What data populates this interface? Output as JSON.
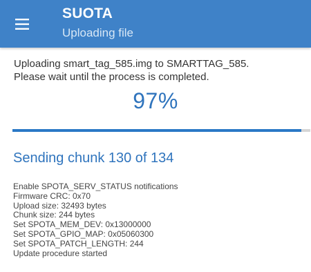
{
  "appbar": {
    "menu_icon": "hamburger-menu-icon",
    "title": "SUOTA",
    "subtitle": "Uploading file",
    "color": "#3f82c8"
  },
  "message": {
    "line1": "Uploading smart_tag_585.img to SMARTTAG_585.",
    "line2": "Please wait until the process is completed."
  },
  "progress": {
    "percent_label": "97%",
    "fraction": 0.97,
    "accent_color": "#2a78c6"
  },
  "status": {
    "chunk_label": "Sending chunk 130 of 134"
  },
  "log": [
    "Enable SPOTA_SERV_STATUS notifications",
    "Firmware CRC: 0x70",
    "Upload size: 32493 bytes",
    "Chunk size: 244 bytes",
    "Set SPOTA_MEM_DEV: 0x13000000",
    "Set SPOTA_GPIO_MAP: 0x05060300",
    "Set SPOTA_PATCH_LENGTH: 244",
    "Update procedure started"
  ]
}
